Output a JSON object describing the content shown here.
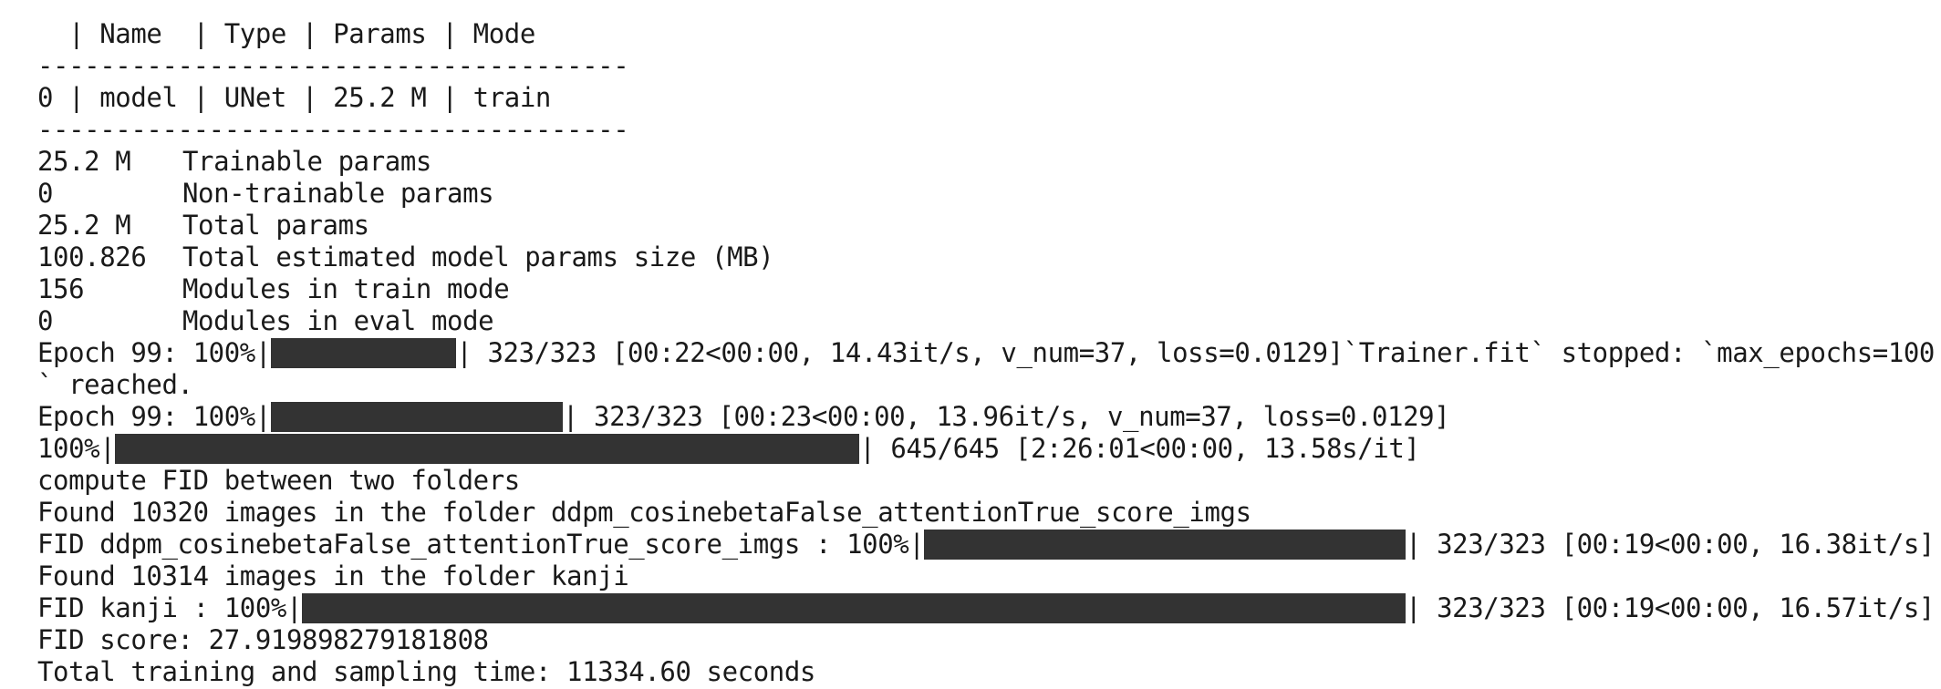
{
  "model_summary": {
    "header": "  | Name  | Type | Params | Mode",
    "separator": "--------------------------------------",
    "rows": [
      "0 | model | UNet | 25.2 M | train"
    ],
    "stats": [
      {
        "value": "25.2 M",
        "label": "Trainable params"
      },
      {
        "value": "0",
        "label": "Non-trainable params"
      },
      {
        "value": "25.2 M",
        "label": "Total params"
      },
      {
        "value": "100.826",
        "label": "Total estimated model params size (MB)"
      },
      {
        "value": "156",
        "label": "Modules in train mode"
      },
      {
        "value": "0",
        "label": "Modules in eval mode"
      }
    ]
  },
  "progress": [
    {
      "prefix": "Epoch 99: 100%|",
      "percent": 100,
      "suffix": "| 323/323 [00:22<00:00, 14.43it/s, v_num=37, loss=0.0129]`Trainer.fit` stopped: `max_epochs=100"
    },
    {
      "prefix": "Epoch 99: 100%|",
      "percent": 100,
      "suffix": "| 323/323 [00:23<00:00, 13.96it/s, v_num=37, loss=0.0129]"
    },
    {
      "prefix": "100%|",
      "percent": 100,
      "suffix": "| 645/645 [2:26:01<00:00, 13.58s/it]"
    },
    {
      "prefix": "FID ddpm_cosinebetaFalse_attentionTrue_score_imgs : 100%|",
      "percent": 100,
      "suffix": "| 323/323 [00:19<00:00, 16.38it/s]"
    },
    {
      "prefix": "FID kanji : 100%|",
      "percent": 100,
      "suffix": "| 323/323 [00:19<00:00, 16.57it/s]"
    }
  ],
  "messages": {
    "trainer_stop_cont": "` reached.",
    "compute_fid": "compute FID between two folders",
    "found_generated": "Found 10320 images in the folder ddpm_cosinebetaFalse_attentionTrue_score_imgs",
    "found_kanji": "Found 10314 images in the folder kanji",
    "fid_score": "FID score: 27.919898279181808",
    "total_time": "Total training and sampling time: 11334.60 seconds"
  }
}
